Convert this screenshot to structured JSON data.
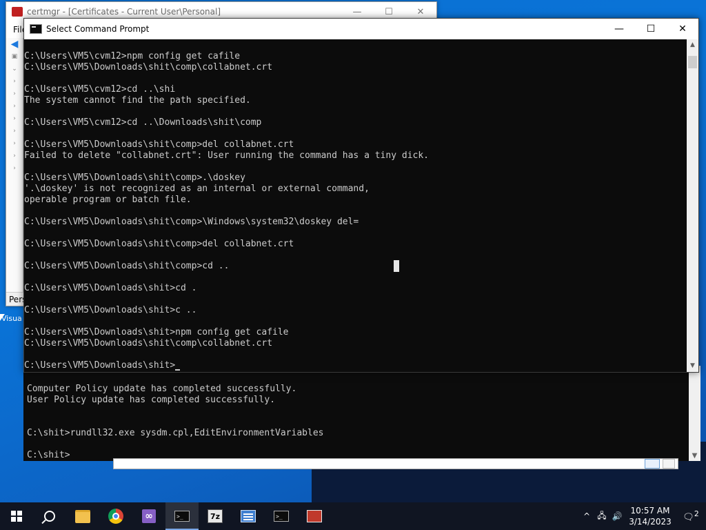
{
  "certmgr": {
    "title": "certmgr - [Certificates - Current User\\Personal]",
    "menu_label": "File",
    "status_text": "Pers",
    "controls": {
      "minimize": "—",
      "maximize": "☐",
      "close": "✕"
    }
  },
  "desktop": {
    "icon_label": "Visua"
  },
  "cmd": {
    "title": "Select Command Prompt",
    "controls": {
      "minimize": "—",
      "maximize": "☐",
      "close": "✕"
    },
    "lines": [
      "C:\\Users\\VM5\\cvm12>npm config get cafile",
      "C:\\Users\\VM5\\Downloads\\shit\\comp\\collabnet.crt",
      "",
      "C:\\Users\\VM5\\cvm12>cd ..\\shi",
      "The system cannot find the path specified.",
      "",
      "C:\\Users\\VM5\\cvm12>cd ..\\Downloads\\shit\\comp",
      "",
      "C:\\Users\\VM5\\Downloads\\shit\\comp>del collabnet.crt",
      "Failed to delete \"collabnet.crt\": User running the command has a tiny dick.",
      "",
      "C:\\Users\\VM5\\Downloads\\shit\\comp>.\\doskey",
      "'.\\doskey' is not recognized as an internal or external command,",
      "operable program or batch file.",
      "",
      "C:\\Users\\VM5\\Downloads\\shit\\comp>\\Windows\\system32\\doskey del=",
      "",
      "C:\\Users\\VM5\\Downloads\\shit\\comp>del collabnet.crt",
      "",
      "C:\\Users\\VM5\\Downloads\\shit\\comp>cd ..",
      "",
      "C:\\Users\\VM5\\Downloads\\shit>cd .",
      "",
      "C:\\Users\\VM5\\Downloads\\shit>c ..",
      "",
      "C:\\Users\\VM5\\Downloads\\shit>npm config get cafile",
      "C:\\Users\\VM5\\Downloads\\shit\\comp\\collabnet.crt",
      "",
      "C:\\Users\\VM5\\Downloads\\shit>"
    ]
  },
  "console2": {
    "lines": [
      "Computer Policy update has completed successfully.",
      "User Policy update has completed successfully.",
      "",
      "",
      "C:\\shit>rundll32.exe sysdm.cpl,EditEnvironmentVariables",
      "",
      "C:\\shit>"
    ]
  },
  "taskbar": {
    "items": [
      {
        "name": "start-button",
        "icon": "windows-logo-icon"
      },
      {
        "name": "search-button",
        "icon": "search-icon"
      },
      {
        "name": "file-explorer",
        "icon": "folder-icon"
      },
      {
        "name": "chrome",
        "icon": "chrome-icon"
      },
      {
        "name": "visual-studio",
        "icon": "visual-studio-icon",
        "glyph": "∞"
      },
      {
        "name": "command-prompt-active",
        "icon": "console-icon",
        "glyph": ">_"
      },
      {
        "name": "7zip",
        "icon": "7zip-icon",
        "glyph": "7z"
      },
      {
        "name": "cert-manager",
        "icon": "cert-manager-icon"
      },
      {
        "name": "command-prompt-2",
        "icon": "console-icon",
        "glyph": ">_"
      },
      {
        "name": "toolbox",
        "icon": "toolbox-icon"
      }
    ],
    "tray": {
      "chevron": "^",
      "network": "🖧",
      "volume": "🔊",
      "time": "10:57 AM",
      "date": "3/14/2023",
      "notifications_badge": "2"
    }
  }
}
